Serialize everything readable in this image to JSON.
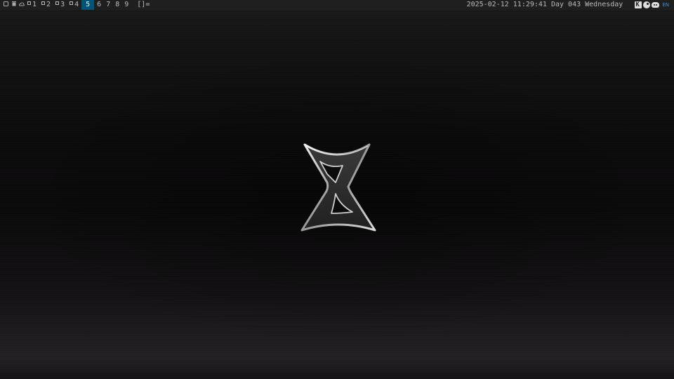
{
  "statusbar": {
    "sys_icons": [
      "window-icon",
      "trash-icon",
      "cloud-icon"
    ],
    "tags": [
      {
        "label": "1",
        "occupied": true,
        "active": false
      },
      {
        "label": "2",
        "occupied": true,
        "active": false
      },
      {
        "label": "3",
        "occupied": true,
        "active": false
      },
      {
        "label": "4",
        "occupied": true,
        "active": false
      },
      {
        "label": "5",
        "occupied": false,
        "active": true
      },
      {
        "label": "6",
        "occupied": false,
        "active": false
      },
      {
        "label": "7",
        "occupied": false,
        "active": false
      },
      {
        "label": "8",
        "occupied": false,
        "active": false
      },
      {
        "label": "9",
        "occupied": false,
        "active": false
      }
    ],
    "layout_symbol": "[]=",
    "clock": "2025-02-12 11:29:41 Day 043 Wednesday",
    "tray_icons": [
      "kde-connect-icon",
      "steam-icon",
      "discord-icon"
    ],
    "keyboard_layout": "EN",
    "active_tag_color": "#005577",
    "bar_color": "#1f1f1f"
  },
  "desktop": {
    "logo_icon": "hourglass-x-logo-icon"
  }
}
